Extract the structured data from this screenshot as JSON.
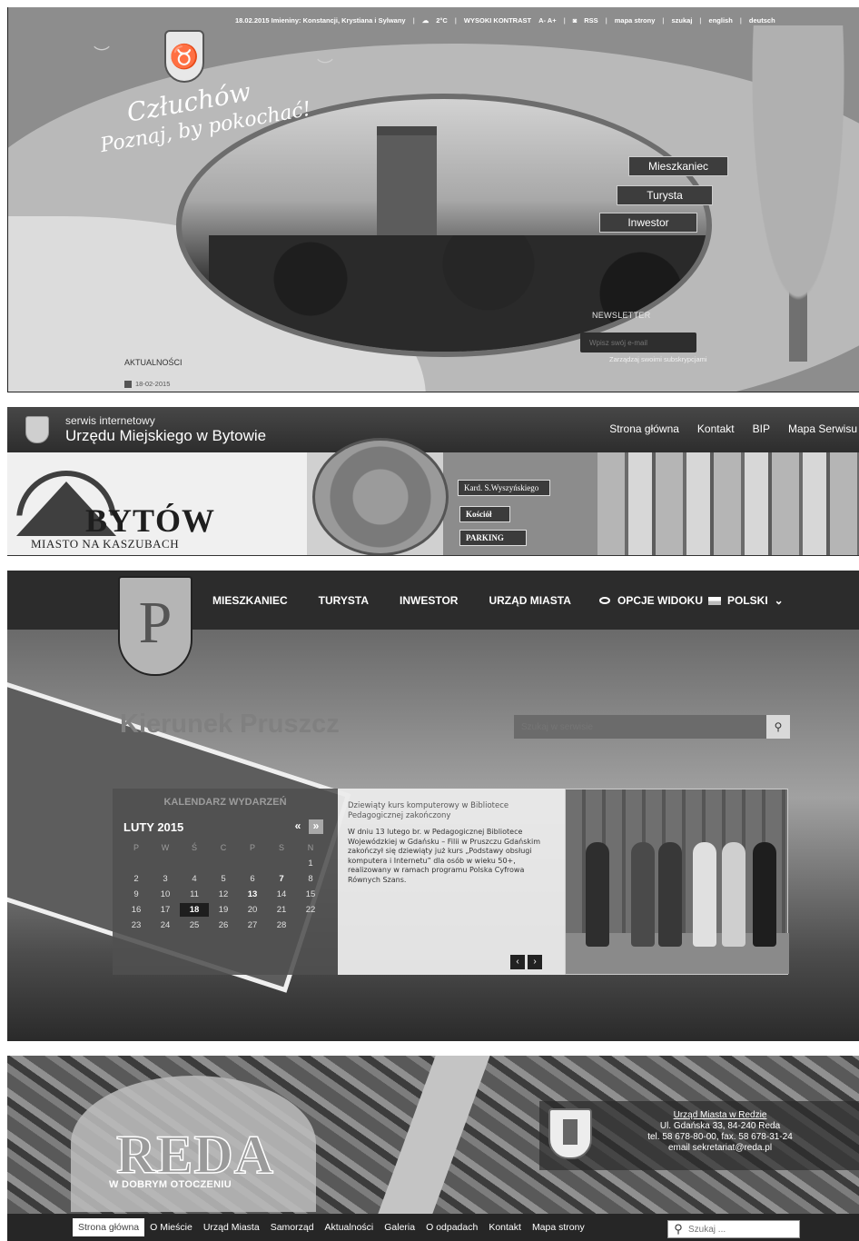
{
  "czluchow": {
    "topbar": {
      "date_names": "18.02.2015  Imieniny: Konstancji, Krystiana i Sylwany",
      "temperature": "2°C",
      "contrast": "WYSOKI KONTRAST",
      "font_size": "A- A+",
      "rss": "RSS",
      "sitemap": "mapa strony",
      "search": "szukaj",
      "english": "english",
      "deutsch": "deutsch"
    },
    "logo_text": "Człuchów",
    "tagline": "Poznaj, by pokochać!",
    "menu": [
      "Mieszkaniec",
      "Turysta",
      "Inwestor"
    ],
    "newsletter": {
      "label": "NEWSLETTER",
      "placeholder": "Wpisz swój e-mail",
      "manage": "Zarządzaj swoimi subskrypcjami"
    },
    "news": {
      "title": "AKTUALNOŚCI",
      "date": "18-02-2015"
    }
  },
  "bytow": {
    "service_line1": "serwis internetowy",
    "service_line2": "Urzędu Miejskiego w Bytowie",
    "nav": [
      "Strona główna",
      "Kontakt",
      "BIP",
      "Mapa Serwisu"
    ],
    "signs": [
      "Kard. S.Wyszyńskiego",
      "Kościół",
      "PARKING"
    ],
    "logo_title": "BYTÓW",
    "logo_subtitle": "MIASTO NA KASZUBACH"
  },
  "pruszcz": {
    "nav": [
      "MIESZKANIEC",
      "TURYSTA",
      "INWESTOR",
      "URZĄD MIASTA"
    ],
    "view_options": "OPCJE WIDOKU",
    "language": "POLSKI",
    "headline": "Kierunek Pruszcz",
    "search_placeholder": "Szukaj w serwisie",
    "calendar": {
      "title": "KALENDARZ WYDARZEŃ",
      "month": "LUTY 2015",
      "prev": "«",
      "next": "»",
      "day_names": [
        "P",
        "W",
        "Ś",
        "C",
        "P",
        "S",
        "N"
      ],
      "weeks": [
        [
          "",
          "",
          "",
          "",
          "",
          "",
          "1"
        ],
        [
          "2",
          "3",
          "4",
          "5",
          "6",
          "7",
          "8"
        ],
        [
          "9",
          "10",
          "11",
          "12",
          "13",
          "14",
          "15"
        ],
        [
          "16",
          "17",
          "18",
          "19",
          "20",
          "21",
          "22"
        ],
        [
          "23",
          "24",
          "25",
          "26",
          "27",
          "28",
          ""
        ]
      ],
      "bold_days": [
        "7",
        "13"
      ],
      "today": "18"
    },
    "news": {
      "title": "Dziewiąty kurs komputerowy w Bibliotece Pedagogicznej zakończony",
      "body": "W dniu 13 lutego br. w Pedagogicznej Bibliotece Wojewódzkiej w Gdańsku – Filii w Pruszczu Gdańskim zakończył się dziewiąty już kurs „Podstawy obsługi komputera i Internetu” dla osób w wieku 50+, realizowany w ramach programu Polska Cyfrowa Równych Szans.",
      "prev": "‹",
      "next": "›"
    }
  },
  "reda": {
    "logo_title": "REDA",
    "logo_subtitle": "W DOBRYM OTOCZENIU",
    "office": {
      "name": "Urząd Miasta w Redzie",
      "address": "Ul. Gdańska 33, 84-240 Reda",
      "phone": "tel. 58 678-80-00, fax. 58 678-31-24",
      "email": "email sekretariat@reda.pl"
    },
    "nav": [
      "Strona główna",
      "O Mieście",
      "Urząd Miasta",
      "Samorząd",
      "Aktualności",
      "Galeria",
      "O odpadach",
      "Kontakt",
      "Mapa strony"
    ],
    "search_placeholder": "Szukaj ..."
  }
}
